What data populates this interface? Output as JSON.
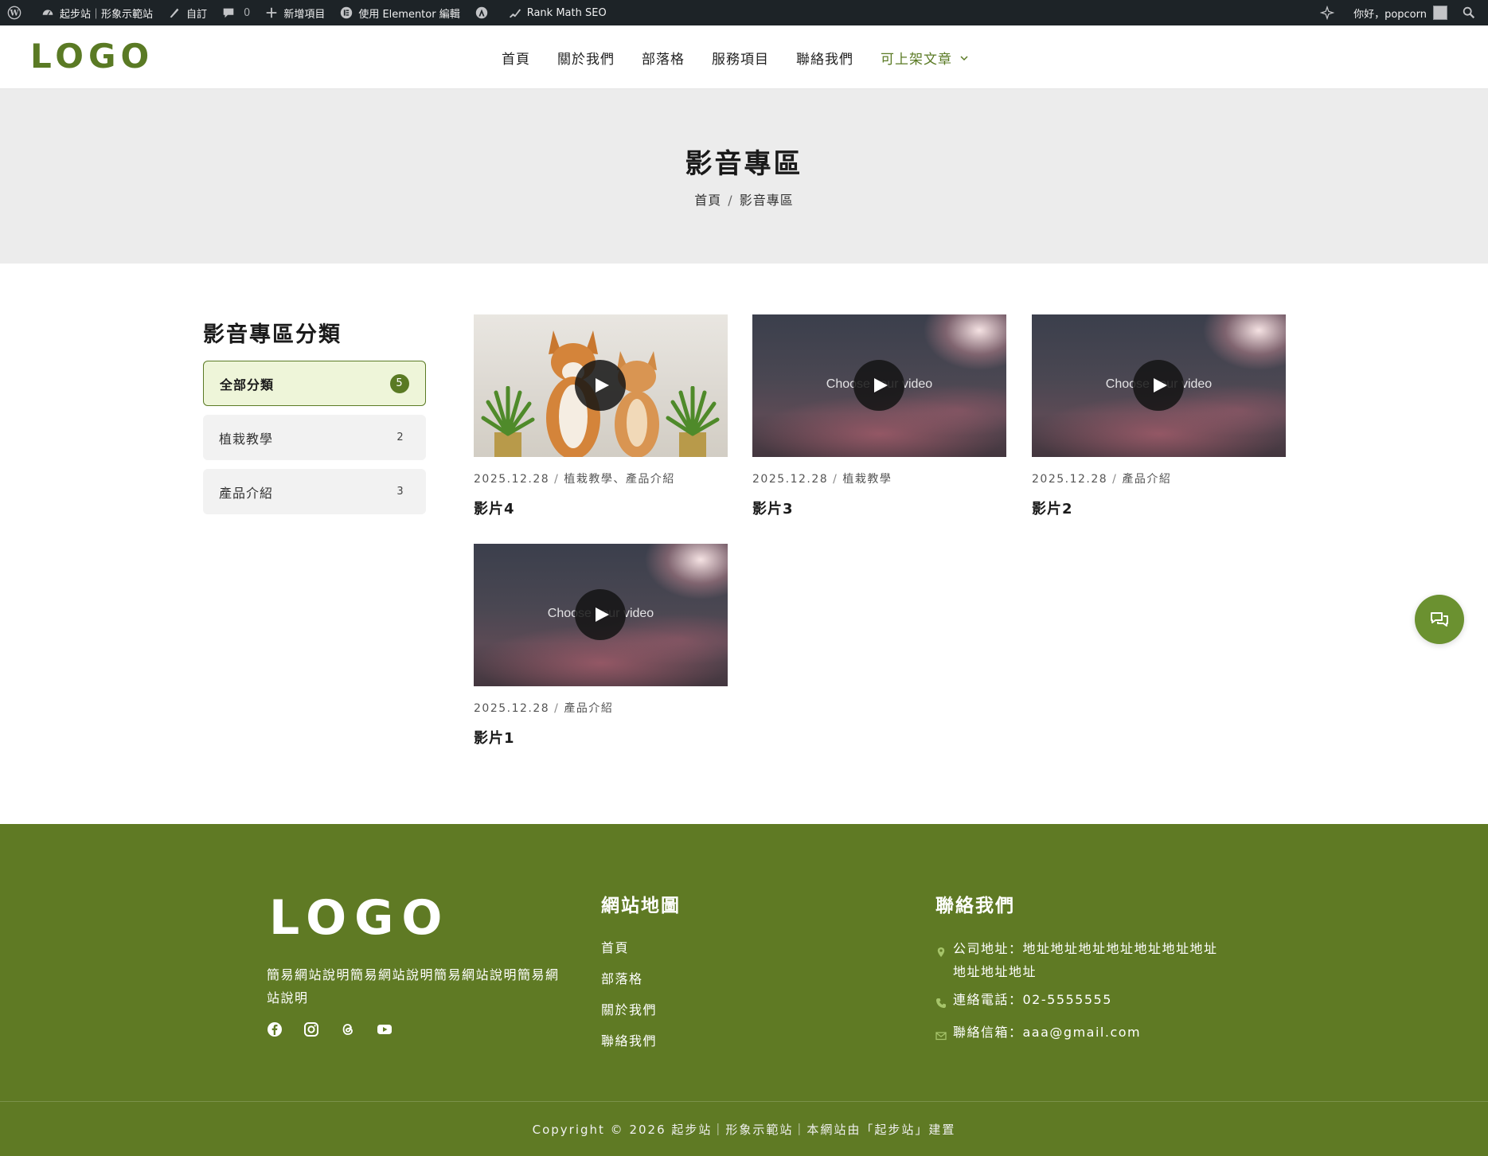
{
  "admin_bar": {
    "site_name": "起步站｜形象示範站",
    "customize": "自訂",
    "comments_count": "0",
    "new_item": "新增項目",
    "elementor": "使用 Elementor 編輯",
    "rank_math": "Rank Math SEO",
    "greeting": "你好，popcorn"
  },
  "header": {
    "logo": "LOGO",
    "nav": [
      {
        "label": "首頁"
      },
      {
        "label": "關於我們"
      },
      {
        "label": "部落格"
      },
      {
        "label": "服務項目"
      },
      {
        "label": "聯絡我們"
      },
      {
        "label": "可上架文章"
      }
    ]
  },
  "page": {
    "title": "影音專區",
    "breadcrumb": [
      "首頁",
      "影音專區"
    ],
    "breadcrumb_sep": "/"
  },
  "sidebar": {
    "title": "影音專區分類",
    "categories": [
      {
        "label": "全部分類",
        "count": "5"
      },
      {
        "label": "植栽教學",
        "count": "2"
      },
      {
        "label": "產品介紹",
        "count": "3"
      }
    ]
  },
  "videos": [
    {
      "date": "2025.12.28",
      "category": "植栽教學、產品介紹",
      "title": "影片4",
      "overlay": ""
    },
    {
      "date": "2025.12.28",
      "category": "植栽教學",
      "title": "影片3",
      "overlay": "Choose your video"
    },
    {
      "date": "2025.12.28",
      "category": "產品介紹",
      "title": "影片2",
      "overlay": "Choose your video"
    },
    {
      "date": "2025.12.28",
      "category": "產品介紹",
      "title": "影片1",
      "overlay": "Choose your video"
    }
  ],
  "footer": {
    "logo": "LOGO",
    "description": "簡易網站說明簡易網站說明簡易網站說明簡易網站說明",
    "social_icons": [
      "facebook-icon",
      "instagram-icon",
      "threads-icon",
      "youtube-icon"
    ],
    "sitemap_title": "網站地圖",
    "sitemap_links": [
      "首頁",
      "部落格",
      "關於我們",
      "聯絡我們"
    ],
    "contact_title": "聯絡我們",
    "address": "公司地址：地址地址地址地址地址地址地址地址地址地址",
    "phone": "連絡電話：02-5555555",
    "email": "聯絡信箱：aaa@gmail.com",
    "copyright": "Copyright © 2026 起步站｜形象示範站｜本網站由「起步站」建置"
  },
  "colors": {
    "brand_green": "#5f7a24",
    "admin_bar": "#1d2327",
    "band_gray": "#ececec"
  }
}
